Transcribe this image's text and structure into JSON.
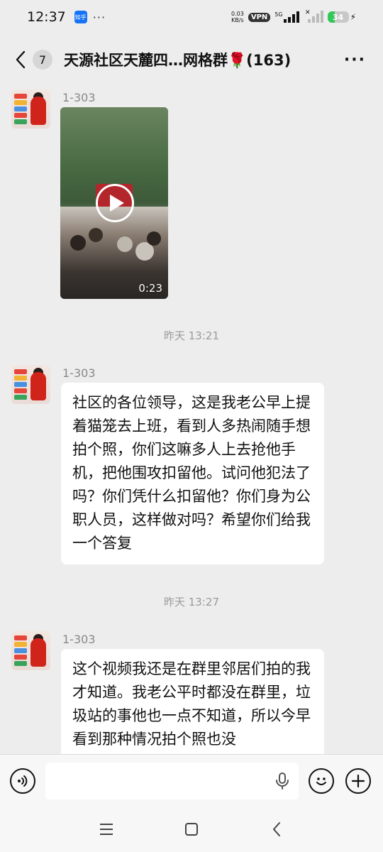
{
  "status_bar": {
    "time": "12:37",
    "app_badge": "知乎",
    "more": "···",
    "net_speed_value": "0.03",
    "net_speed_unit": "KB/s",
    "vpn": "VPN",
    "signal_type": "5G",
    "battery": "34"
  },
  "header": {
    "unread_count": "7",
    "title": "天源社区天麓四…网格群🌹(163)",
    "more": "···"
  },
  "messages": [
    {
      "sender": "1-303",
      "type": "video",
      "duration": "0:23"
    },
    {
      "timestamp": "昨天 13:21"
    },
    {
      "sender": "1-303",
      "type": "text",
      "text": "社区的各位领导，这是我老公早上提着猫笼去上班，看到人多热闹随手想拍个照，你们这嘛多人上去抢他手机，把他围攻扣留他。试问他犯法了吗？你们凭什么扣留他？你们身为公职人员，这样做对吗？希望你们给我一个答复"
    },
    {
      "timestamp": "昨天 13:27"
    },
    {
      "sender": "1-303",
      "type": "text",
      "text": "这个视频我还是在群里邻居们拍的我才知道。我老公平时都没在群里，垃圾站的事他也一点不知道，所以今早看到那种情况拍个照也没"
    }
  ],
  "input": {
    "placeholder": ""
  },
  "colors": {
    "background": "#ededed",
    "bubble": "#ffffff",
    "battery": "#34c759"
  },
  "battery_level": 0.34
}
